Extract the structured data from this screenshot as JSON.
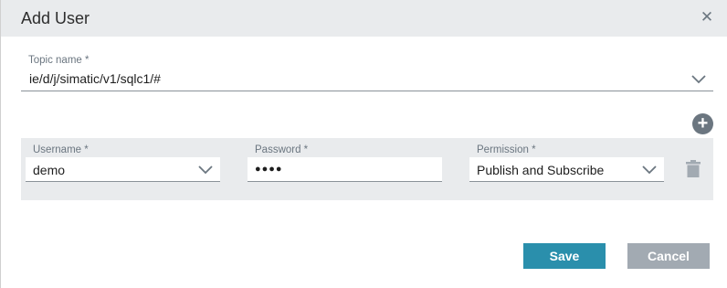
{
  "dialog": {
    "title": "Add User",
    "close_icon": "close-icon"
  },
  "topic": {
    "label": "Topic name *",
    "value": "ie/d/j/simatic/v1/sqlc1/#"
  },
  "user_row": {
    "username": {
      "label": "Username *",
      "value": "demo"
    },
    "password": {
      "label": "Password *",
      "value": "●●●●"
    },
    "permission": {
      "label": "Permission *",
      "value": "Publish and Subscribe"
    }
  },
  "actions": {
    "add_user_icon": "plus-icon",
    "delete_icon": "trash-icon",
    "add_symbol": "+",
    "close_symbol": "✕",
    "save_label": "Save",
    "cancel_label": "Cancel"
  },
  "colors": {
    "primary": "#2a8fac",
    "secondary": "#a2aab2",
    "header_bg": "#e9ebed",
    "icon": "#6b7680"
  }
}
